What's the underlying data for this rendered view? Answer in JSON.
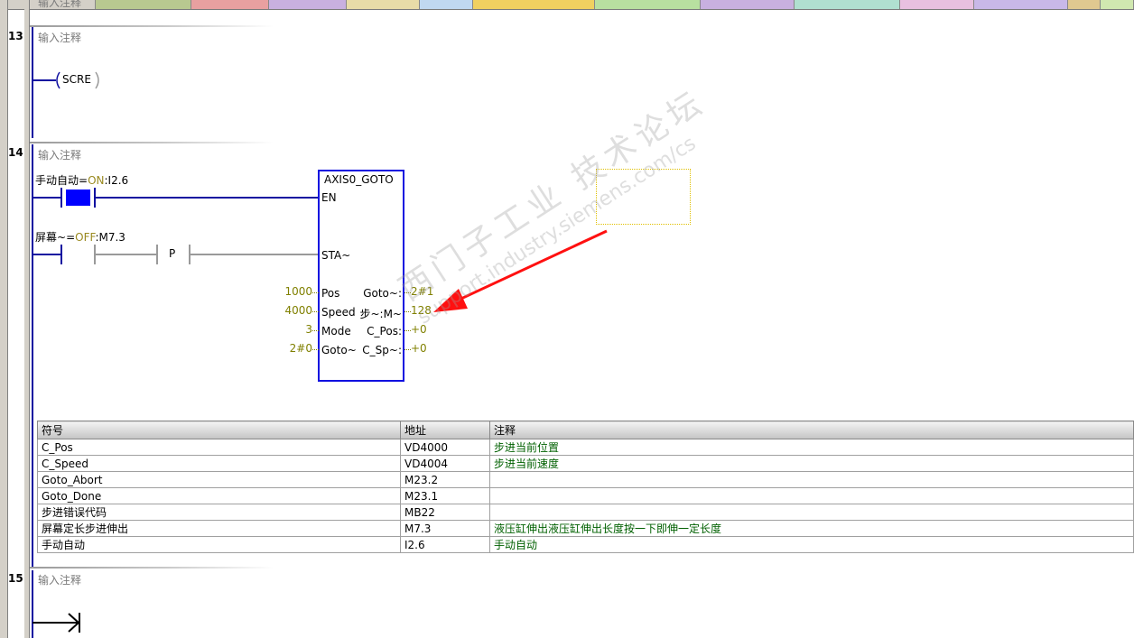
{
  "top_strip_colors": [
    "#d4d0c8",
    "#b8c890",
    "#e8a0a0",
    "#c8b0e0",
    "#e8dca8",
    "#c0d8f0",
    "#f0d060",
    "#b8e0a0",
    "#c8b0e0",
    "#b0e0d0",
    "#e8c0e0",
    "#c8b8e8",
    "#e0c890",
    "#d0e8b0"
  ],
  "top_partial_text": "输入注释",
  "networks": {
    "n13": {
      "number": "13",
      "comment": "输入注释",
      "coil_text": "SCRE"
    },
    "n14": {
      "number": "14",
      "comment": "输入注释",
      "contact1": {
        "name": "手动自动",
        "eq": "=",
        "state": "ON",
        "address": ":I2.6"
      },
      "contact2": {
        "name": "屏幕~",
        "eq": "=",
        "state": "OFF",
        "address": ":M7.3"
      },
      "p_label": "P",
      "block": {
        "title": "AXIS0_GOTO",
        "pins": {
          "en": "EN",
          "sta": "STA~",
          "pos": "Pos",
          "speed": "Speed",
          "mode": "Mode",
          "goto_abort": "Goto~"
        },
        "outputs": {
          "goto_done": "Goto~:",
          "step_err": "步~:M~",
          "c_pos": "C_Pos:",
          "c_speed": "C_Sp~:"
        },
        "inputs_values": {
          "pos": "1000",
          "speed": "4000",
          "mode": "3",
          "goto_abort": "2#0"
        },
        "outputs_values": {
          "goto_done": "2#1",
          "step_err": "128",
          "c_pos": "+0",
          "c_speed": "+0"
        }
      }
    },
    "n15": {
      "number": "15",
      "comment": "输入注释"
    }
  },
  "symbol_table": {
    "headers": [
      "符号",
      "地址",
      "注释"
    ],
    "rows": [
      [
        "C_Pos",
        "VD4000",
        "步进当前位置"
      ],
      [
        "C_Speed",
        "VD4004",
        "步进当前速度"
      ],
      [
        "Goto_Abort",
        "M23.2",
        ""
      ],
      [
        "Goto_Done",
        "M23.1",
        ""
      ],
      [
        "步进错误代码",
        "MB22",
        ""
      ],
      [
        "屏幕定长步进伸出",
        "M7.3",
        "液压缸伸出液压缸伸出长度按一下即伸一定长度"
      ],
      [
        "手动自动",
        "I2.6",
        "手动自动"
      ]
    ]
  },
  "watermark": {
    "line1": "西门子工业  技术论坛",
    "line2": "support.industry.siemens.com/cs"
  }
}
